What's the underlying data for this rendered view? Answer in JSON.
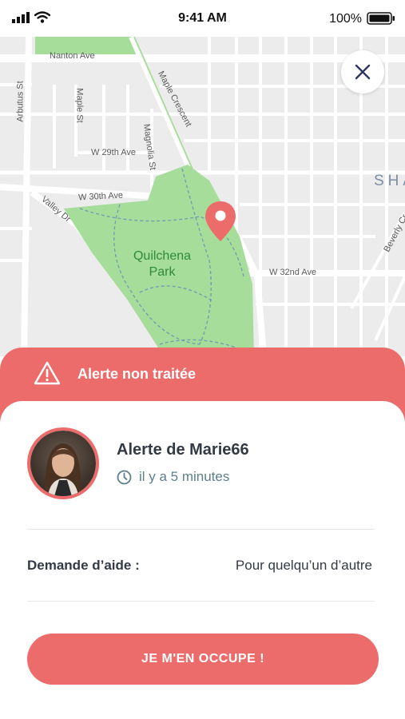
{
  "status_bar": {
    "time": "9:41 AM",
    "battery": "100%"
  },
  "map": {
    "streets": {
      "nanton": "Nanton Ave",
      "arbutus": "Arbutus St",
      "maple_st": "Maple St",
      "maple_crescent": "Maple Crescent",
      "magnolia": "Magnolia St",
      "w29": "W 29th Ave",
      "w30": "W 30th Ave",
      "valley": "Valley Dr",
      "w32": "W 32nd Ave",
      "beverly": "Beverly Cr"
    },
    "park_name_line1": "Quilchena",
    "park_name_line2": "Park",
    "district_label": "SHA",
    "colors": {
      "park": "#a6dd9a",
      "road": "#ffffff",
      "land": "#ececec",
      "pin": "#ec6c6c"
    }
  },
  "alert": {
    "header_title": "Alerte non traitée",
    "from_label": "Alerte de Marie66",
    "time_ago": "il y a 5 minutes",
    "help_label": "Demande d’aide :",
    "help_value": "Pour quelqu’un d’autre",
    "cta_label": "JE M'EN OCCUPE !"
  },
  "icons": [
    "signal-icon",
    "wifi-icon",
    "battery-icon",
    "close-icon",
    "map-pin-icon",
    "warning-icon",
    "clock-icon"
  ],
  "accent_color": "#ec6c6c"
}
